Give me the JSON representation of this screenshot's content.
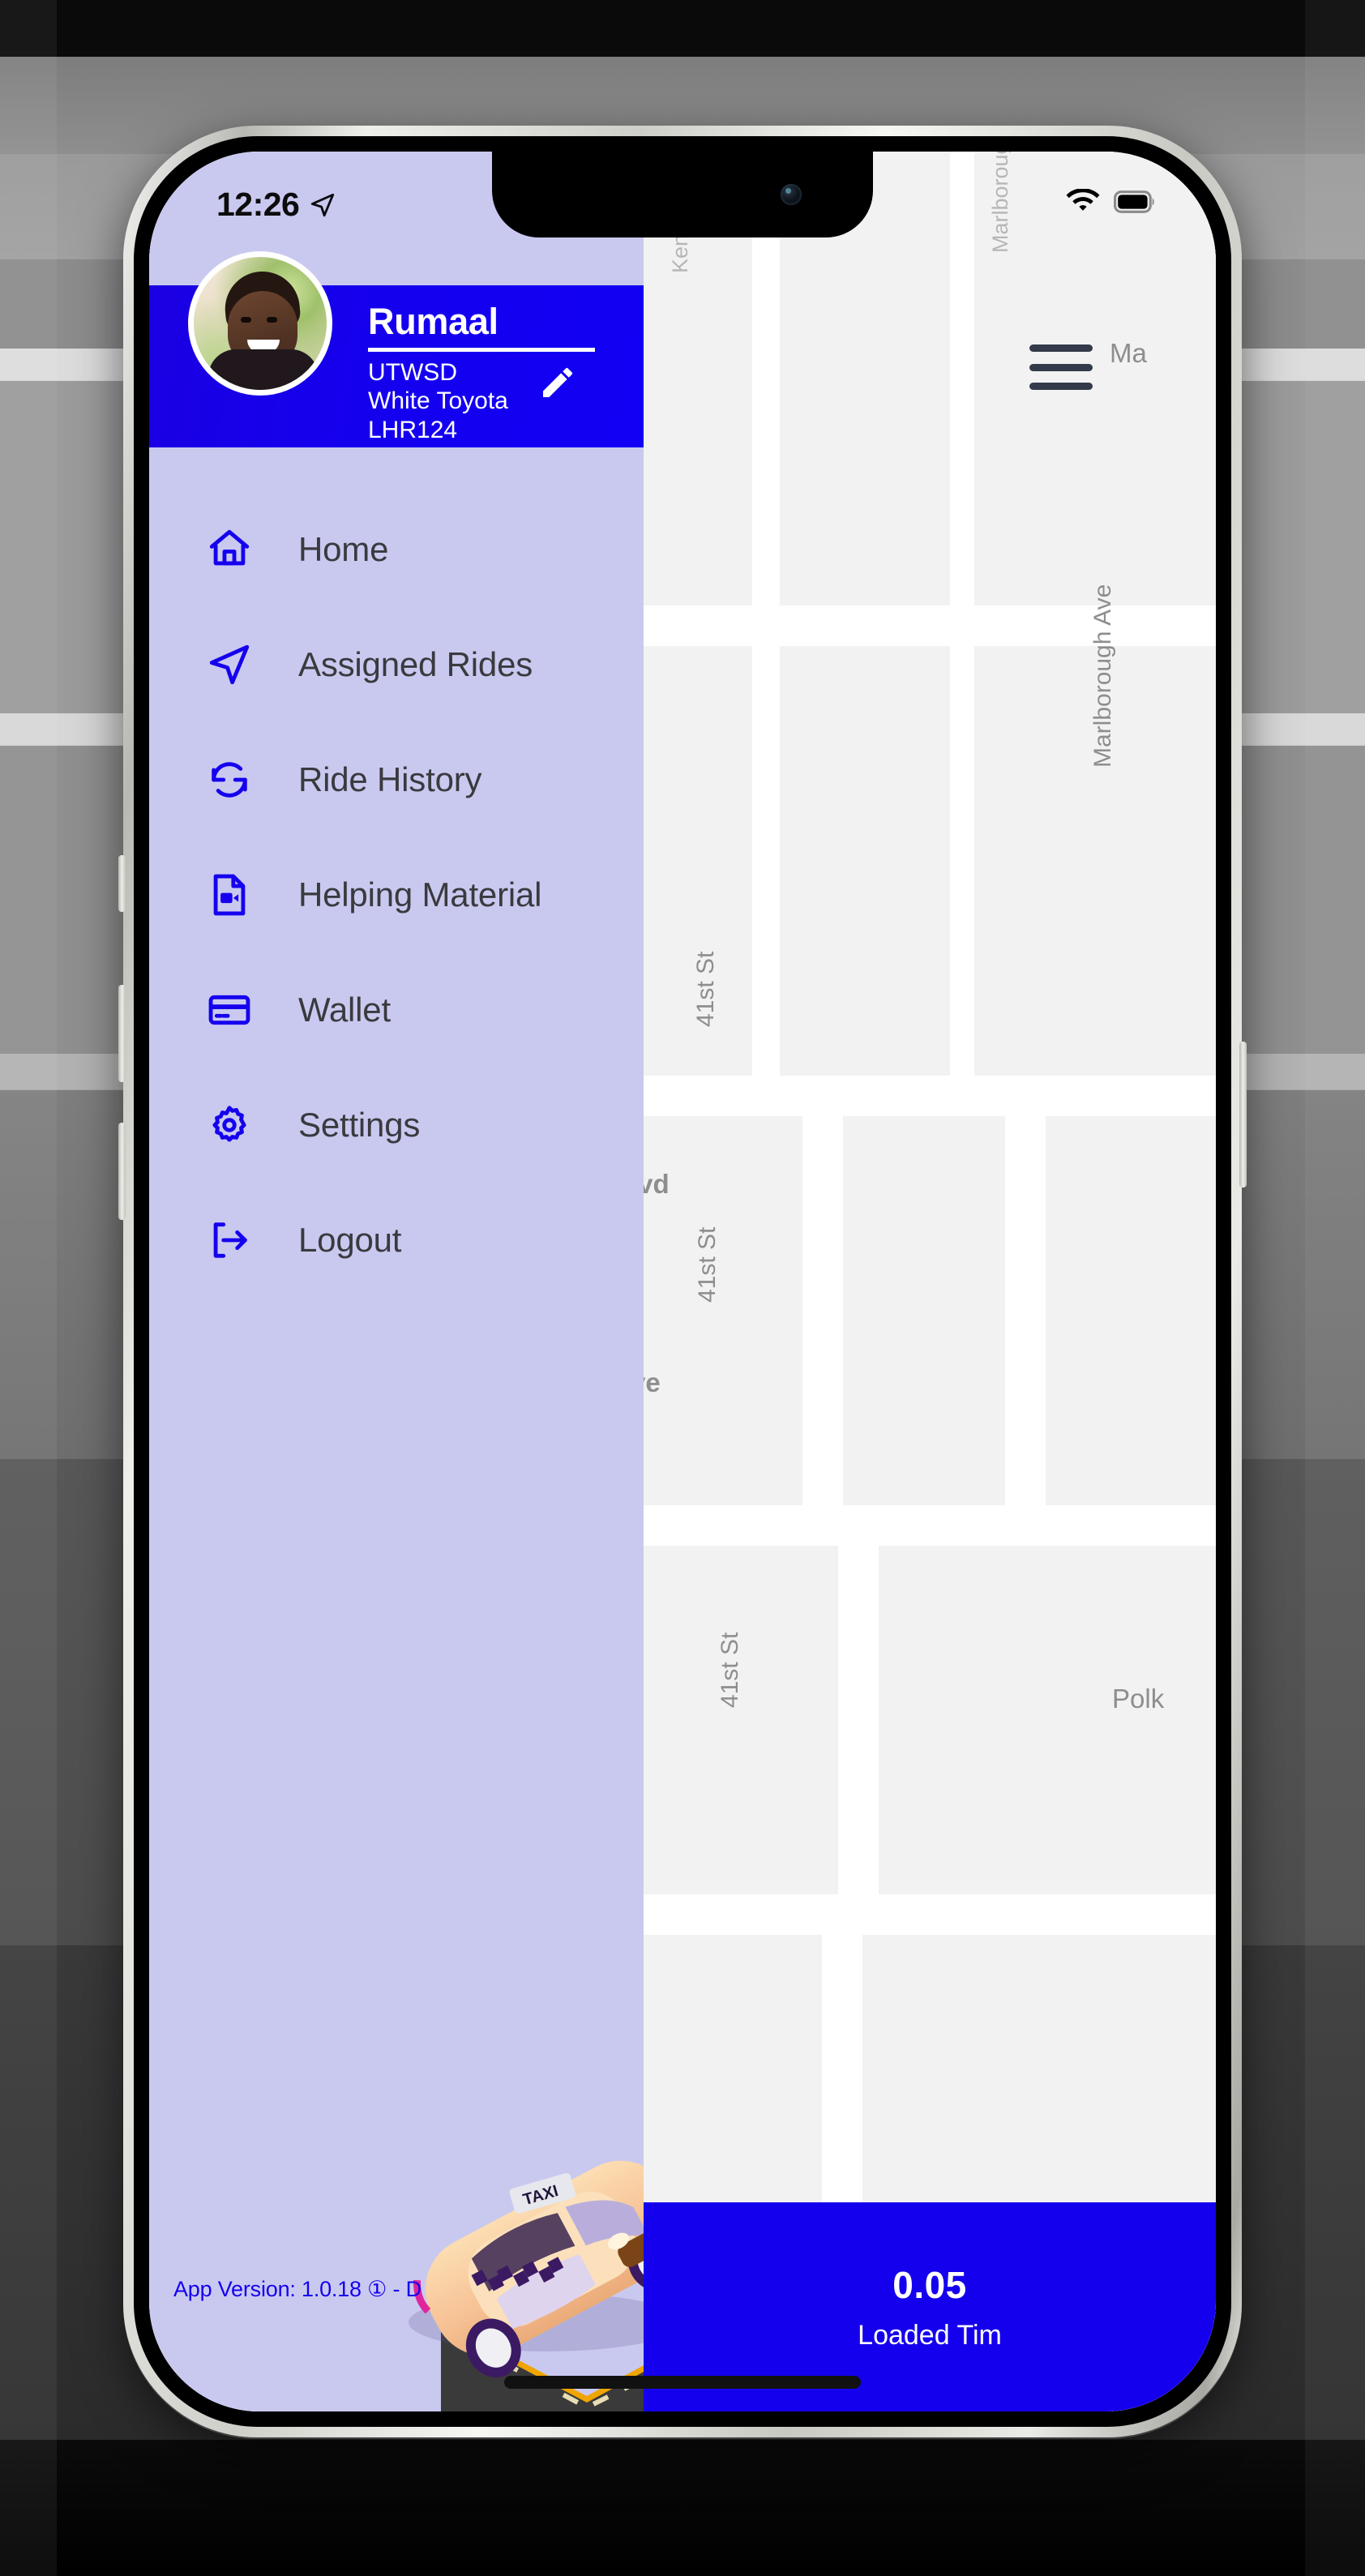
{
  "status_bar": {
    "time": "12:26",
    "location_icon": "location-arrow-icon",
    "wifi_icon": "wifi-icon",
    "battery_icon": "battery-full-icon"
  },
  "drawer": {
    "profile": {
      "name": "Rumaal",
      "company_code": "UTWSD",
      "vehicle": "White Toyota",
      "plate": "LHR124",
      "edit_icon": "pencil-edit-icon",
      "avatar": "driver-avatar"
    },
    "menu": [
      {
        "label": "Home",
        "icon": "home-icon"
      },
      {
        "label": "Assigned Rides",
        "icon": "navigation-arrow-icon"
      },
      {
        "label": "Ride History",
        "icon": "refresh-history-icon"
      },
      {
        "label": "Helping Material",
        "icon": "video-file-icon"
      },
      {
        "label": "Wallet",
        "icon": "credit-card-icon"
      },
      {
        "label": "Settings",
        "icon": "gear-icon"
      },
      {
        "label": "Logout",
        "icon": "logout-arrow-icon"
      }
    ],
    "app_version": "App Version: 1.0.18 ① - D",
    "illustration": "taxi-on-road-illustration"
  },
  "map": {
    "menu_icon": "hamburger-menu-icon",
    "labels": [
      "Kensington",
      "Marlborough",
      "Ma",
      "Marlborough Ave",
      "41st St",
      "lvd",
      "41st St",
      "ve",
      "41st St",
      "Polk"
    ]
  },
  "loaded_panel": {
    "value": "0.05",
    "label": "Loaded Tim"
  },
  "colors": {
    "accent_blue": "#1500ee",
    "drawer_bg": "#c9c9f0",
    "menu_text": "#3a3a3f"
  }
}
